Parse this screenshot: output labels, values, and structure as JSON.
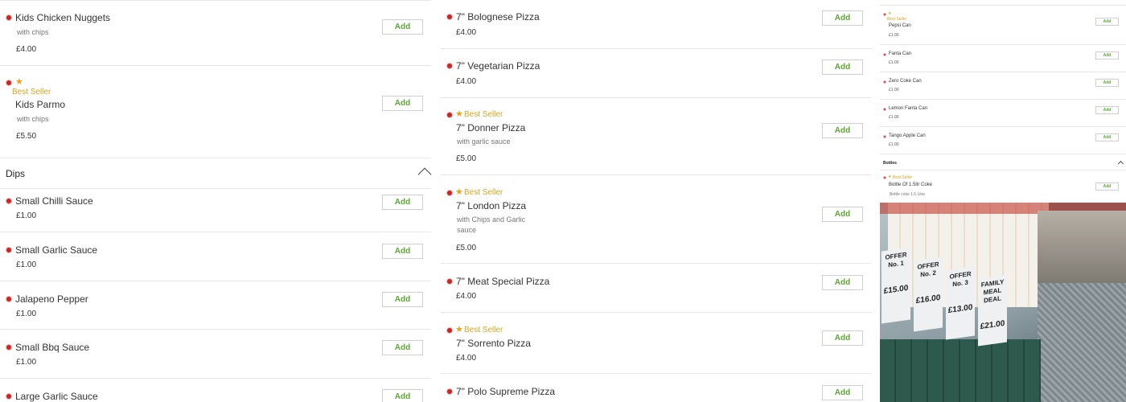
{
  "column1": {
    "items_top": [
      {
        "name": "Kids Chicken Nuggets",
        "desc": "with chips",
        "price": "£4.00",
        "add": "Add",
        "best_seller": false
      },
      {
        "name": "Kids Parmo",
        "desc": "with chips",
        "price": "£5.50",
        "add": "Add",
        "best_seller": true,
        "best_seller_label": "Best Seller"
      }
    ],
    "category": {
      "title": "Dips"
    },
    "items_dips": [
      {
        "name": "Small Chilli Sauce",
        "price": "£1.00",
        "add": "Add"
      },
      {
        "name": "Small Garlic Sauce",
        "price": "£1.00",
        "add": "Add"
      },
      {
        "name": "Jalapeno Pepper",
        "price": "£1.00",
        "add": "Add"
      },
      {
        "name": "Small Bbq Sauce",
        "price": "£1.00",
        "add": "Add"
      },
      {
        "name": "Large Garlic Sauce",
        "price": "",
        "add": "Add"
      }
    ]
  },
  "column2": {
    "items": [
      {
        "name": "7\" Bolognese Pizza",
        "price": "£4.00",
        "add": "Add"
      },
      {
        "name": "7\" Vegetarian Pizza",
        "price": "£4.00",
        "add": "Add"
      },
      {
        "name": "7\" Donner Pizza",
        "desc": "with garlic sauce",
        "price": "£5.00",
        "add": "Add",
        "best_seller_label": "Best Seller"
      },
      {
        "name": "7\" London Pizza",
        "desc": "with Chips and Garlic sauce",
        "price": "£5.00",
        "add": "Add",
        "best_seller_label": "Best Seller"
      },
      {
        "name": "7\" Meat Special Pizza",
        "price": "£4.00",
        "add": "Add"
      },
      {
        "name": "7\" Sorrento Pizza",
        "price": "£4.00",
        "add": "Add",
        "best_seller_label": "Best Seller"
      },
      {
        "name": "7\" Polo Supreme Pizza",
        "add": "Add"
      }
    ]
  },
  "column3": {
    "items": [
      {
        "name": "Pepsi Can",
        "price": "£1.00",
        "add": "Add",
        "best_seller_label": "Best Seller"
      },
      {
        "name": "Fanta Can",
        "price": "£1.00",
        "add": "Add"
      },
      {
        "name": "Zero Coke Can",
        "price": "£1.00",
        "add": "Add"
      },
      {
        "name": "Lemon Fanta Can",
        "price": "£1.00",
        "add": "Add"
      },
      {
        "name": "Tango Apple Can",
        "price": "£1.00",
        "add": "Add"
      }
    ],
    "category": {
      "title": "Bottles"
    },
    "bottle_item": {
      "name": "Bottle Of 1.5ltr Coke",
      "desc": "Bottle coke 1.5 Litre",
      "add": "Add",
      "best_seller_label": "Best Seller"
    },
    "photo": {
      "offers": [
        {
          "title": "OFFER No. 1",
          "price": "£15.00"
        },
        {
          "title": "OFFER No. 2",
          "price": "£16.00"
        },
        {
          "title": "OFFER No. 3",
          "price": "£13.00"
        },
        {
          "title": "FAMILY MEAL DEAL",
          "price": "£21.00"
        }
      ]
    }
  },
  "colors": {
    "accent_green": "#5aa832",
    "best_seller": "#d9a520",
    "dot_red": "#c62828"
  },
  "icons": [
    "dot-icon",
    "star-icon",
    "chevron-up-icon"
  ]
}
